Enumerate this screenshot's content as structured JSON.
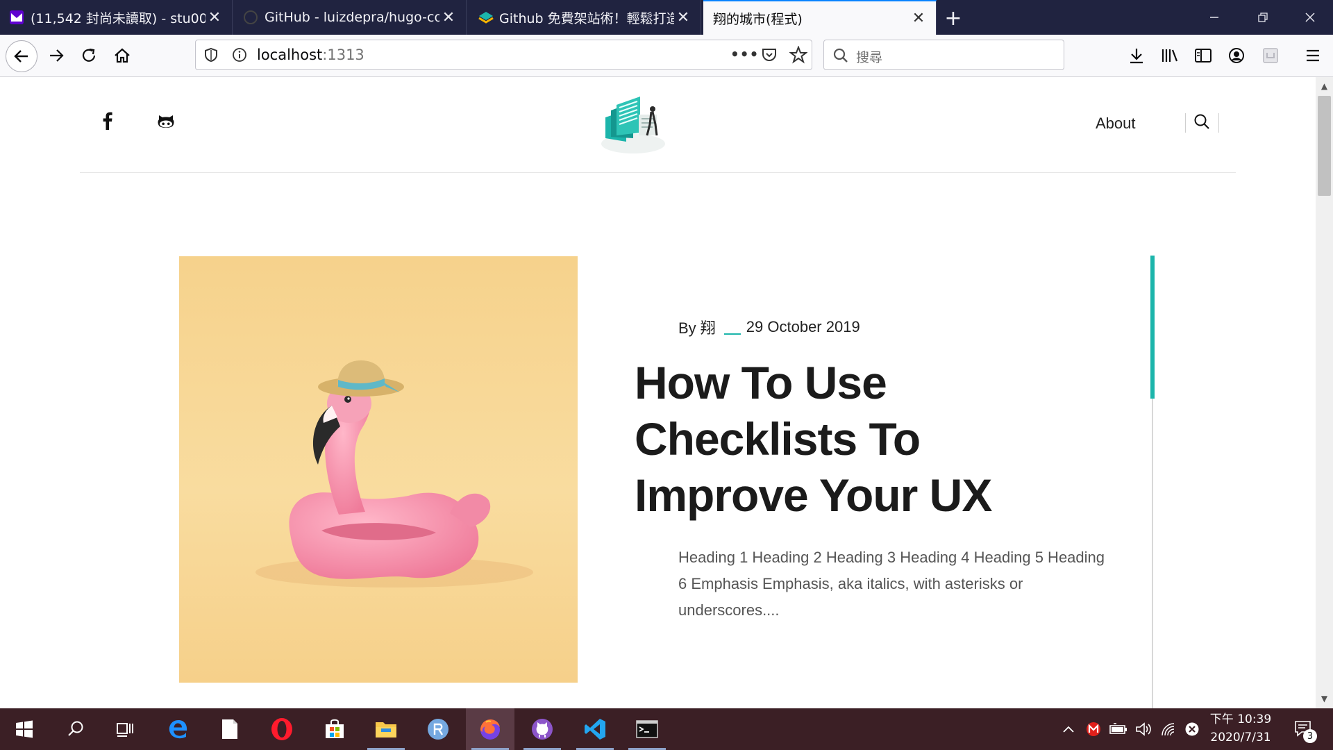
{
  "browser": {
    "tabs": [
      {
        "title": "(11,542 封尚未讀取) - stu0020",
        "close": "✕"
      },
      {
        "title": "GitHub - luizdepra/hugo-cod",
        "close": "✕"
      },
      {
        "title": "Github 免費架站術！輕鬆打造",
        "close": "✕"
      },
      {
        "title": "翔的城市(程式)",
        "close": "✕"
      }
    ],
    "new_tab": "+",
    "url": {
      "host": "localhost",
      "port": ":1313"
    },
    "search_placeholder": "搜尋",
    "page_actions": "•••"
  },
  "site": {
    "nav_about": "About",
    "post": {
      "author": "By 翔",
      "date": "29 October 2019",
      "title": "How To Use Checklists To Improve Your UX",
      "excerpt": "Heading 1 Heading 2 Heading 3 Heading 4 Heading 5 Heading 6 Emphasis Emphasis, aka italics, with asterisks or underscores...."
    },
    "social": [
      "facebook-icon",
      "github-icon"
    ],
    "accent_color": "#1cb5ab"
  },
  "taskbar": {
    "apps": [
      "start",
      "search",
      "task-view",
      "edge",
      "notepad",
      "opera",
      "store",
      "explorer",
      "r",
      "firefox",
      "github-desktop",
      "vscode",
      "terminal"
    ],
    "time": "下午 10:39",
    "date": "2020/7/31",
    "notification_count": "3"
  }
}
